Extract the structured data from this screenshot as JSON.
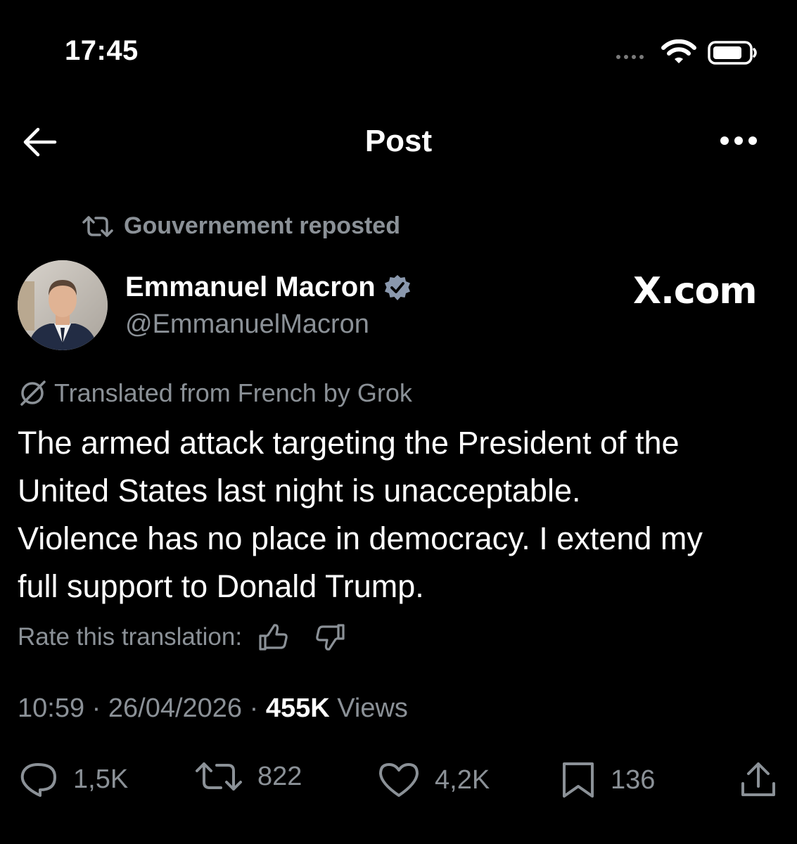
{
  "status_bar": {
    "time": "17:45"
  },
  "header": {
    "title": "Post"
  },
  "post": {
    "repost_label": "Gouvernement reposted",
    "author_name": "Emmanuel Macron",
    "author_handle": "@EmmanuelMacron",
    "watermark": "X.com",
    "translation_label": "Translated from French by Grok",
    "body": "The armed attack targeting the President of the\nUnited States last night is unacceptable.\nViolence has no place in democracy. I extend my\nfull support to Donald Trump.",
    "rate_label": "Rate this translation:",
    "time": "10:59",
    "date": "26/04/2026",
    "separator": "·",
    "views_count": "455K",
    "views_label": "Views"
  },
  "actions": {
    "replies": "1,5K",
    "reposts": "822",
    "likes": "4,2K",
    "bookmarks": "136"
  },
  "colors": {
    "background": "#000000",
    "text_primary": "#ffffff",
    "text_secondary": "#8b9197",
    "verified_badge": "#8a98ad"
  },
  "icons": [
    "wifi-icon",
    "battery-icon",
    "back-arrow-icon",
    "more-icon",
    "repost-icon",
    "verified-badge-icon",
    "grok-icon",
    "thumbs-up-icon",
    "thumbs-down-icon",
    "reply-icon",
    "like-icon",
    "bookmark-icon",
    "share-icon"
  ]
}
